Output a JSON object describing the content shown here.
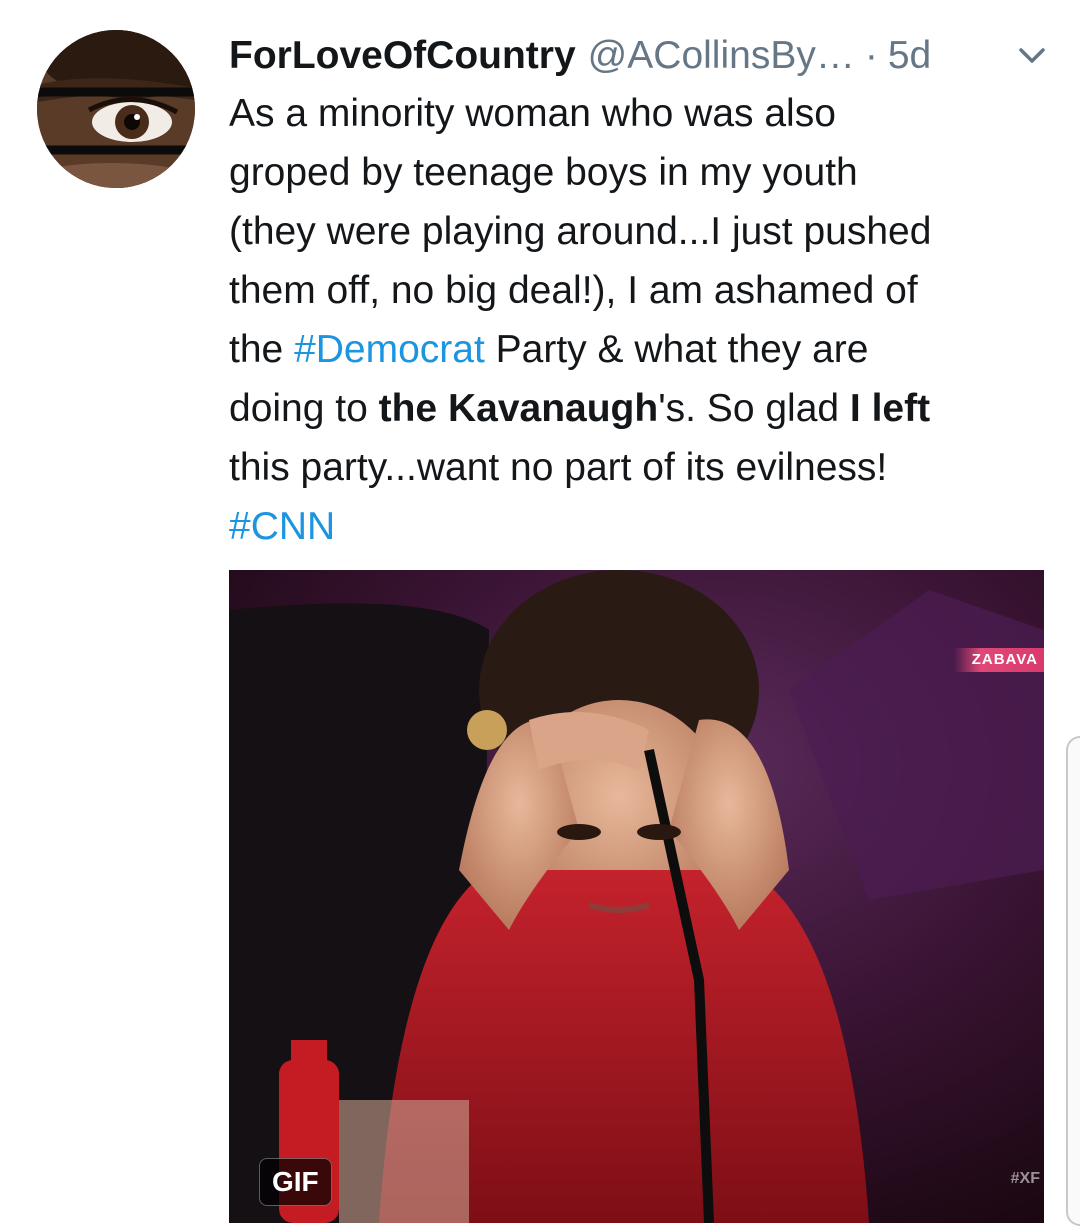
{
  "tweet": {
    "display_name": "ForLoveOfCountry",
    "handle": "@ACollinsBy…",
    "separator": "·",
    "timestamp": "5d",
    "avatar_icon": "profile-photo-eye-glasses",
    "menu_icon": "chevron-down-icon",
    "text_lines": [
      [
        {
          "t": "As a minority woman who was also"
        }
      ],
      [
        {
          "t": "groped by teenage boys in my youth"
        }
      ],
      [
        {
          "t": "(they were playing around...I just pushed"
        }
      ],
      [
        {
          "t": "them off, no big deal!), I am ashamed of"
        }
      ],
      [
        {
          "t": "the "
        },
        {
          "t": "#Democrat",
          "style": "hashtag"
        },
        {
          "t": " Party & what they are"
        }
      ],
      [
        {
          "t": "doing to "
        },
        {
          "t": "the Kavanaugh",
          "style": "bold"
        },
        {
          "t": "'s.  So glad "
        },
        {
          "t": "I left",
          "style": "bold"
        }
      ],
      [
        {
          "t": "this party...want no part of its evilness!"
        }
      ],
      [
        {
          "t": "#CNN",
          "style": "hashtag"
        }
      ]
    ],
    "media": {
      "type": "gif",
      "badge_label": "GIF",
      "watermark": "ZABAVA",
      "watermark_corner": "#XF"
    }
  },
  "colors": {
    "text": "#14171a",
    "secondary": "#657786",
    "hashtag": "#1b95e0"
  }
}
